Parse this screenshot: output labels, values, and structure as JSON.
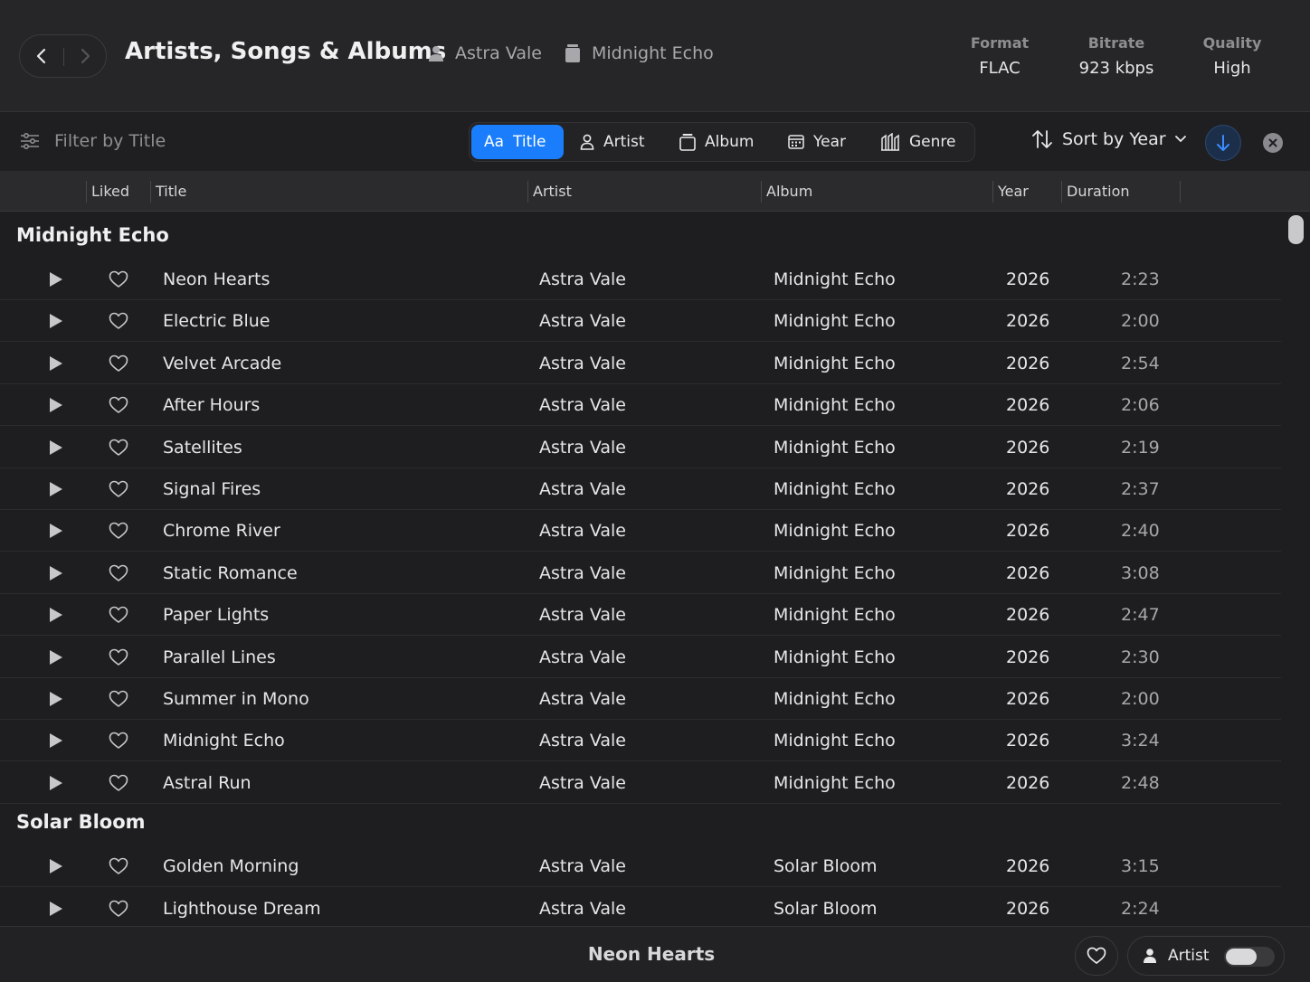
{
  "header": {
    "title": "Artists, Songs & Albums",
    "artist": "Astra Vale",
    "album": "Midnight Echo",
    "meta": [
      {
        "key": "Format",
        "value": "FLAC"
      },
      {
        "key": "Bitrate",
        "value": "923 kbps"
      },
      {
        "key": "Quality",
        "value": "High"
      }
    ]
  },
  "toolbar": {
    "filter_placeholder": "Filter by Title",
    "segments": [
      {
        "icon": "aa-icon",
        "icon_text": "Aa",
        "label": "Title",
        "active": true
      },
      {
        "icon": "person-icon",
        "label": "Artist",
        "active": false
      },
      {
        "icon": "album-icon",
        "label": "Album",
        "active": false
      },
      {
        "icon": "calendar-icon",
        "label": "Year",
        "active": false
      },
      {
        "icon": "genre-icon",
        "label": "Genre",
        "active": false
      }
    ],
    "sort_label": "Sort by Year",
    "sort_direction": "descending",
    "accent": "#1a7dfb"
  },
  "columns": [
    "Liked",
    "Title",
    "Artist",
    "Album",
    "Year",
    "Duration"
  ],
  "groups": [
    {
      "title": "Midnight Echo",
      "songs": [
        {
          "title": "Neon Hearts",
          "artist": "Astra Vale",
          "album": "Midnight Echo",
          "year": "2026",
          "duration": "2:23"
        },
        {
          "title": "Electric Blue",
          "artist": "Astra Vale",
          "album": "Midnight Echo",
          "year": "2026",
          "duration": "2:00"
        },
        {
          "title": "Velvet Arcade",
          "artist": "Astra Vale",
          "album": "Midnight Echo",
          "year": "2026",
          "duration": "2:54"
        },
        {
          "title": "After Hours",
          "artist": "Astra Vale",
          "album": "Midnight Echo",
          "year": "2026",
          "duration": "2:06"
        },
        {
          "title": "Satellites",
          "artist": "Astra Vale",
          "album": "Midnight Echo",
          "year": "2026",
          "duration": "2:19"
        },
        {
          "title": "Signal Fires",
          "artist": "Astra Vale",
          "album": "Midnight Echo",
          "year": "2026",
          "duration": "2:37"
        },
        {
          "title": "Chrome River",
          "artist": "Astra Vale",
          "album": "Midnight Echo",
          "year": "2026",
          "duration": "2:40"
        },
        {
          "title": "Static Romance",
          "artist": "Astra Vale",
          "album": "Midnight Echo",
          "year": "2026",
          "duration": "3:08"
        },
        {
          "title": "Paper Lights",
          "artist": "Astra Vale",
          "album": "Midnight Echo",
          "year": "2026",
          "duration": "2:47"
        },
        {
          "title": "Parallel Lines",
          "artist": "Astra Vale",
          "album": "Midnight Echo",
          "year": "2026",
          "duration": "2:30"
        },
        {
          "title": "Summer in Mono",
          "artist": "Astra Vale",
          "album": "Midnight Echo",
          "year": "2026",
          "duration": "2:00"
        },
        {
          "title": "Midnight Echo",
          "artist": "Astra Vale",
          "album": "Midnight Echo",
          "year": "2026",
          "duration": "3:24"
        },
        {
          "title": "Astral Run",
          "artist": "Astra Vale",
          "album": "Midnight Echo",
          "year": "2026",
          "duration": "2:48"
        }
      ]
    },
    {
      "title": "Solar Bloom",
      "songs": [
        {
          "title": "Golden Morning",
          "artist": "Astra Vale",
          "album": "Solar Bloom",
          "year": "2026",
          "duration": "3:15"
        },
        {
          "title": "Lighthouse Dream",
          "artist": "Astra Vale",
          "album": "Solar Bloom",
          "year": "2026",
          "duration": "2:24"
        }
      ]
    }
  ],
  "footer": {
    "now_playing": "Neon Hearts",
    "artist_toggle_label": "Artist",
    "artist_toggle_on": false
  }
}
